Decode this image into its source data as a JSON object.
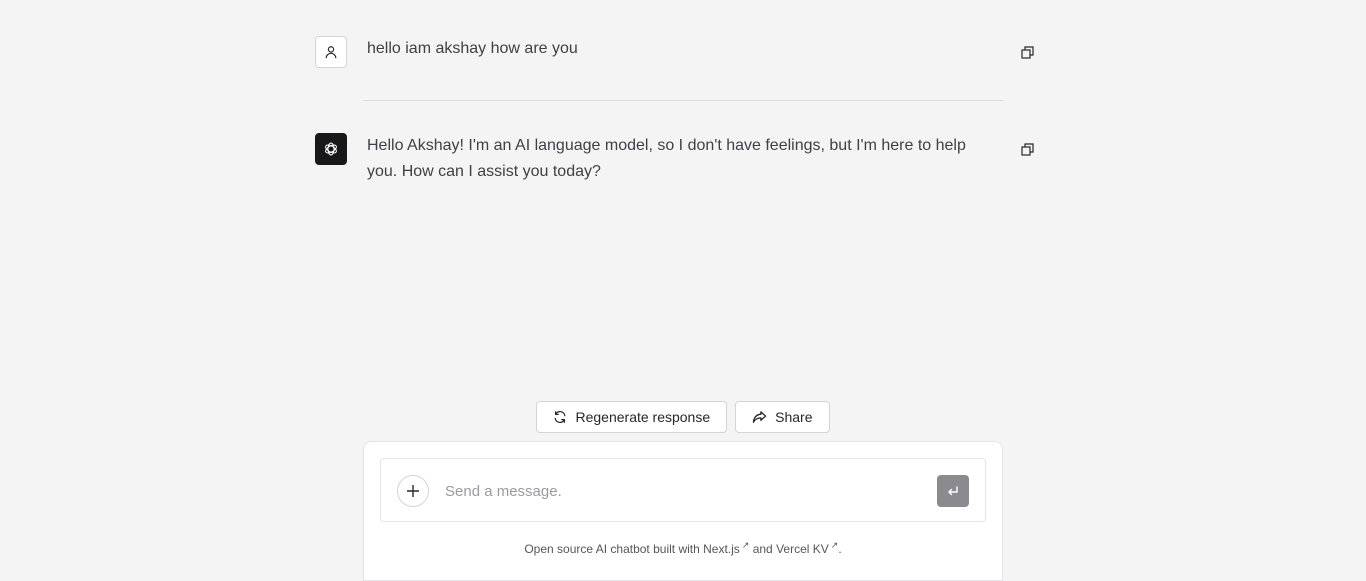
{
  "conversation": {
    "user_message": "hello iam akshay how are you",
    "assistant_message": "Hello Akshay! I'm an AI language model, so I don't have feelings, but I'm here to help you. How can I assist you today?"
  },
  "actions": {
    "regenerate_label": "Regenerate response",
    "share_label": "Share"
  },
  "composer": {
    "placeholder": "Send a message."
  },
  "footer": {
    "prefix": "Open source AI chatbot built with ",
    "link1": "Next.js",
    "middle": " and ",
    "link2": "Vercel KV",
    "suffix": ".",
    "external_mark": "↗"
  },
  "icons": {
    "user_avatar": "user-icon",
    "assistant_avatar": "openai-logo-icon",
    "copy": "copy-icon",
    "regenerate": "refresh-icon",
    "share": "share-icon",
    "new_chat": "plus-icon",
    "send": "enter-icon"
  },
  "colors": {
    "background": "#f4f4f4",
    "assistant_avatar_bg": "#18181b",
    "send_button_bg": "#8b8b8f"
  }
}
